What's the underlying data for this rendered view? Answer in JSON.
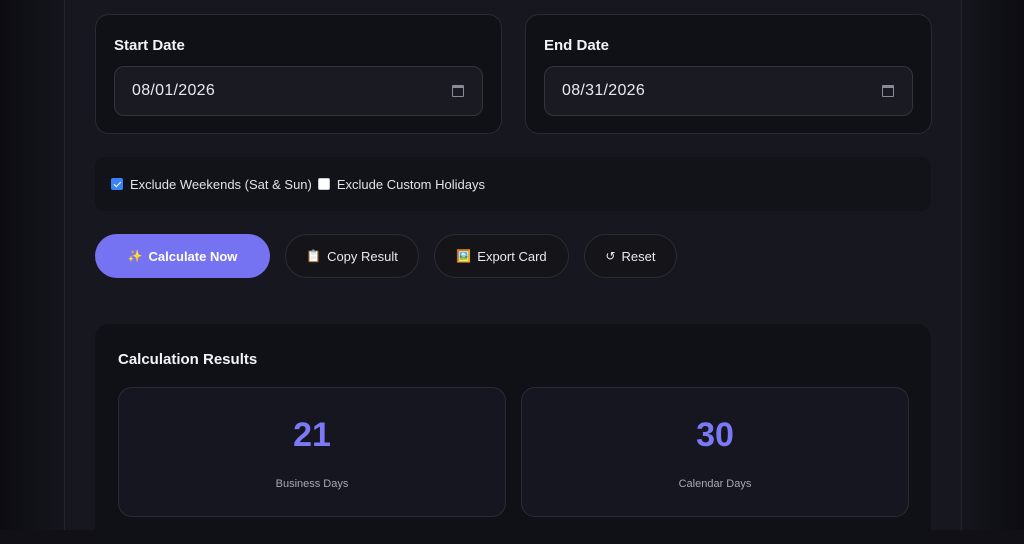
{
  "dates": {
    "start": {
      "label": "Start Date",
      "value": "08/01/2026"
    },
    "end": {
      "label": "End Date",
      "value": "08/31/2026"
    }
  },
  "options": {
    "exclude_weekends": {
      "label": "Exclude Weekends (Sat & Sun)",
      "checked": true
    },
    "exclude_holidays": {
      "label": "Exclude Custom Holidays",
      "checked": false
    }
  },
  "actions": {
    "calculate": {
      "icon": "✨",
      "label": "Calculate Now"
    },
    "copy": {
      "icon": "📋",
      "label": "Copy Result"
    },
    "export": {
      "icon": "🖼️",
      "label": "Export Card"
    },
    "reset": {
      "icon": "↺",
      "label": "Reset"
    }
  },
  "results": {
    "title": "Calculation Results",
    "business_days": {
      "value": "21",
      "label": "Business Days"
    },
    "calendar_days": {
      "value": "30",
      "label": "Calendar Days"
    }
  },
  "colors": {
    "accent": "#7573f2",
    "accent_text": "#7b79f5",
    "checkbox": "#3b82f6",
    "background": "#101016"
  }
}
